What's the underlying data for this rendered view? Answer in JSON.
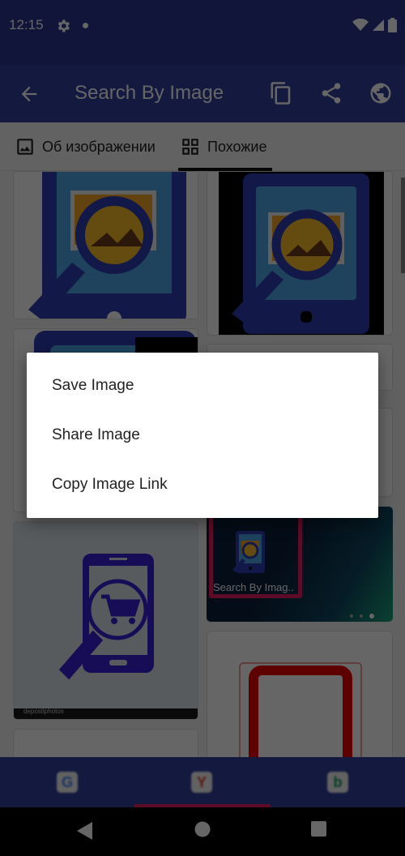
{
  "status_bar": {
    "time": "12:15",
    "icons": [
      "gear-icon",
      "notification-dot",
      "wifi-icon",
      "signal-icon",
      "battery-icon"
    ]
  },
  "app_bar": {
    "title": "Search By Image",
    "back_icon": "arrow-back-icon",
    "actions": [
      "copy-icon",
      "share-icon",
      "globe-icon"
    ]
  },
  "tabs": [
    {
      "label": "Об изображении",
      "icon": "image-icon",
      "selected": false
    },
    {
      "label": "Похожие",
      "icon": "grid-icon",
      "selected": true
    }
  ],
  "results": {
    "cards": [
      {
        "description": "tablet with magnifier over photo icon (blue)"
      },
      {
        "description": "tablet with magnifier on black background"
      },
      {
        "description": "tablet with magnifier (partially hidden)"
      },
      {
        "description": "blank card (partially hidden)"
      },
      {
        "description": "phone with magnifier and shopping cart",
        "watermark": "depositphotos"
      },
      {
        "description": "app screenshot with Search By Image icon",
        "caption": "Search By Imag.."
      },
      {
        "description": "red square outline icon"
      },
      {
        "description": "blank card"
      }
    ]
  },
  "context_menu": {
    "items": [
      {
        "label": "Save Image"
      },
      {
        "label": "Share Image"
      },
      {
        "label": "Copy Image Link"
      }
    ]
  },
  "bottom_nav": {
    "items": [
      {
        "name": "google",
        "icon": "google-icon",
        "selected": false
      },
      {
        "name": "yandex",
        "icon": "yandex-icon",
        "selected": true
      },
      {
        "name": "bing",
        "icon": "bing-icon",
        "selected": false
      }
    ],
    "accent": "#e91e63"
  },
  "system_nav": {
    "buttons": [
      "back-icon",
      "home-icon",
      "recents-icon"
    ]
  },
  "colors": {
    "primary": "#303f9f",
    "primary_dark": "#2a3590",
    "accent": "#e91e63"
  }
}
